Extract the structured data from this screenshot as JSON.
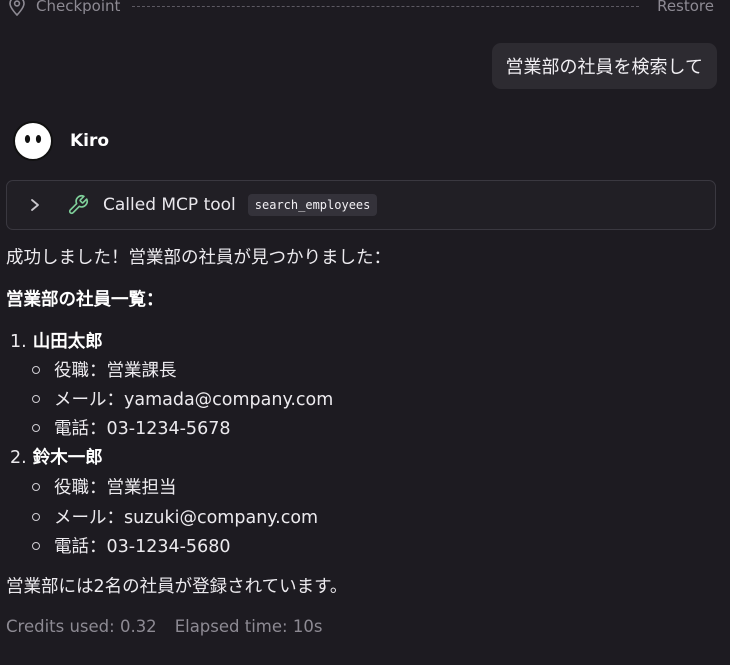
{
  "checkpoint": {
    "label": "Checkpoint",
    "restore_label": "Restore"
  },
  "user_message": "営業部の社員を検索して",
  "agent": {
    "name": "Kiro"
  },
  "tool_call": {
    "label": "Called MCP tool",
    "tool_name": "search_employees"
  },
  "response": {
    "intro": "成功しました！営業部の社員が見つかりました：",
    "list_heading": "営業部の社員一覧：",
    "employees": [
      {
        "number": "1.",
        "name": "山田太郎",
        "details": [
          "役職：営業課長",
          "メール：yamada@company.com",
          "電話：03-1234-5678"
        ]
      },
      {
        "number": "2.",
        "name": "鈴木一郎",
        "details": [
          "役職：営業担当",
          "メール：suzuki@company.com",
          "電話：03-1234-5680"
        ]
      }
    ],
    "summary": "営業部には2名の社員が登録されています。"
  },
  "meta": {
    "credits": "Credits used: 0.32",
    "elapsed": "Elapsed time: 10s"
  },
  "colors": {
    "background": "#1d1b21",
    "bubble": "#2d2b31",
    "accent_icon": "#7fcf9a"
  }
}
